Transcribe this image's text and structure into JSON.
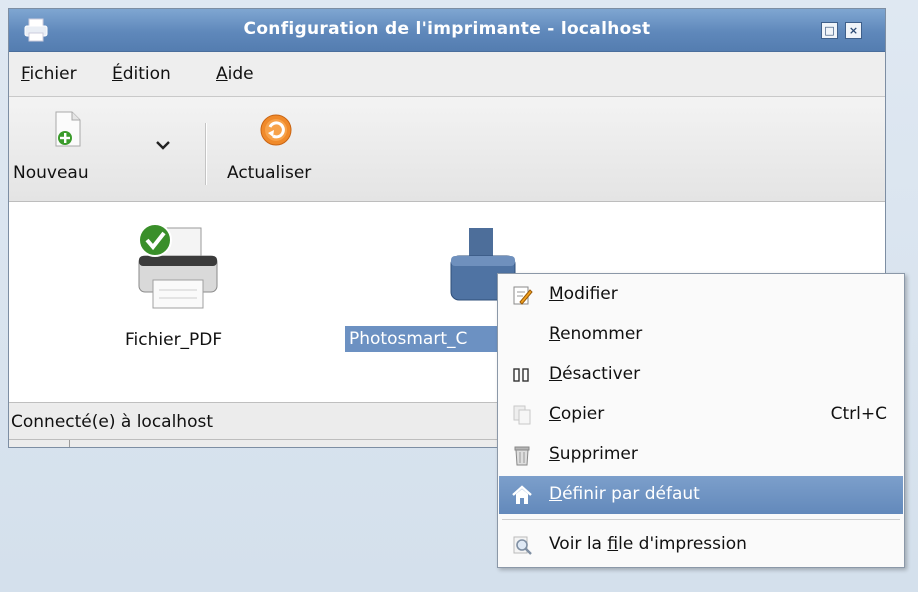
{
  "window": {
    "title": "Configuration de l'imprimante - localhost",
    "maximize_glyph": "□",
    "close_glyph": "×"
  },
  "menu": {
    "items": [
      {
        "label_ul": "F",
        "label_rest": "ichier"
      },
      {
        "label_ul": "É",
        "label_rest": "dition"
      },
      {
        "label_ul": "A",
        "label_rest": "ide"
      }
    ]
  },
  "toolbar": {
    "new_label": "Nouveau",
    "refresh_label": "Actualiser"
  },
  "printers": [
    {
      "name": "Fichier_PDF",
      "is_default": true,
      "selected": false
    },
    {
      "name": "Photosmart_C",
      "is_default": false,
      "selected": true
    }
  ],
  "status": {
    "text": "Connecté(e) à localhost"
  },
  "context_menu": {
    "items": [
      {
        "icon": "edit-icon",
        "ul": "M",
        "rest": "odifier",
        "accel": ""
      },
      {
        "icon": "",
        "ul": "R",
        "rest": "enommer",
        "accel": ""
      },
      {
        "icon": "pause-icon",
        "ul": "D",
        "rest": "ésactiver",
        "accel": ""
      },
      {
        "icon": "copy-icon",
        "ul": "C",
        "rest": "opier",
        "accel": "Ctrl+C"
      },
      {
        "icon": "trash-icon",
        "ul": "S",
        "rest": "upprimer",
        "accel": ""
      },
      {
        "icon": "home-icon",
        "ul": "D",
        "rest": "éfinir par défaut",
        "accel": "",
        "highlighted": true
      },
      {
        "icon": "search-icon",
        "pre": "Voir la ",
        "ul": "f",
        "rest": "ile d'impression",
        "accel": ""
      }
    ]
  },
  "colors": {
    "titlebar": "#6a92c4",
    "selection": "#6c91c2",
    "desktop": "#d9e4ef"
  }
}
